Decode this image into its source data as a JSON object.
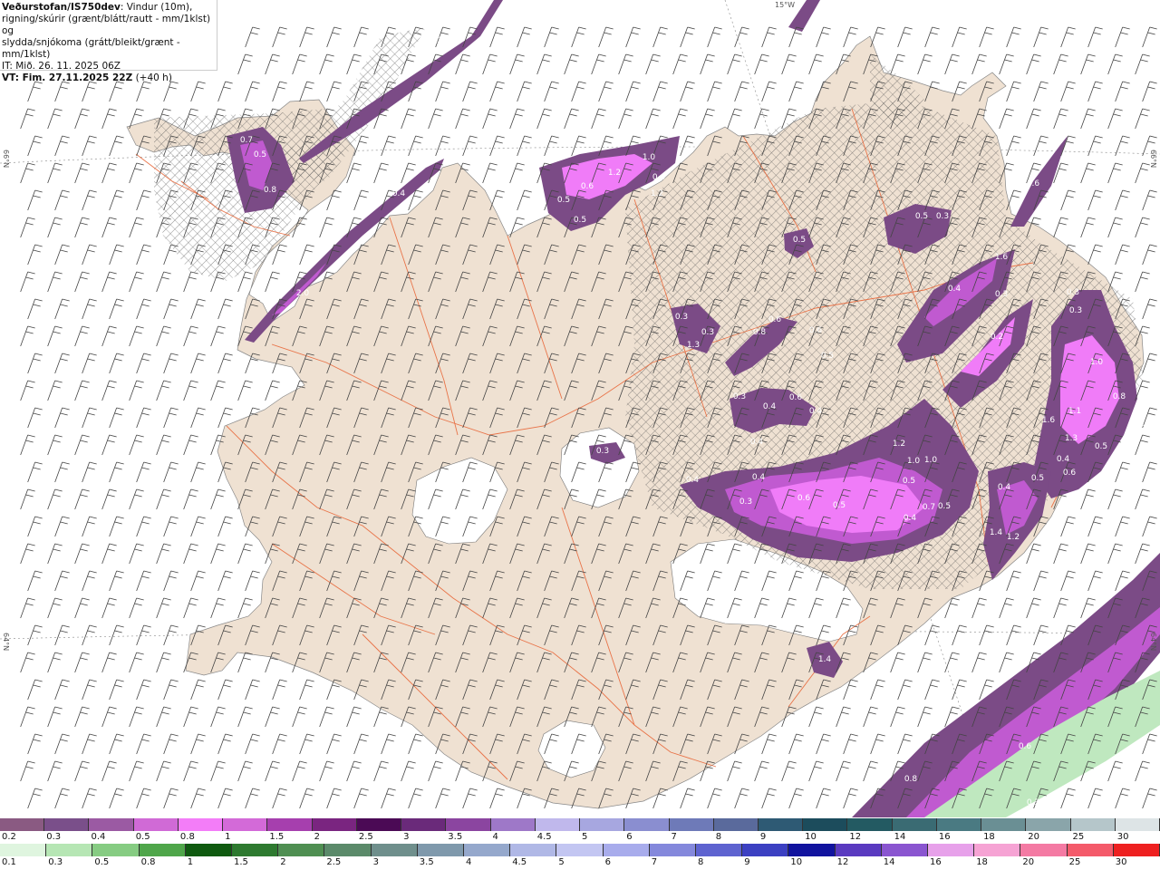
{
  "header": {
    "source": "Veðurstofan/IS750dev",
    "desc1": ": Vindur (10m),",
    "desc2": "rigning/skúrir (grænt/blátt/rautt - mm/1klst) og",
    "desc3": "slydda/snjókoma (grátt/bleikt/grænt - mm/1klst)",
    "it": "IT: Mið. 26. 11. 2025 06Z",
    "vt_label": "VT: Fim. 27.11.2025 22Z",
    "vt_offset": " (+40 h)"
  },
  "graticule": {
    "lat_66": "66°N",
    "lat_64": "64°N",
    "lon_15": "15°W"
  },
  "map_values": [
    "0.7",
    "0.5",
    "0.8",
    "0.5",
    "2.0",
    "0.4",
    "1.0",
    "1.2",
    "0.5",
    "0.6",
    "1.2",
    "0.4",
    "0.5",
    "0.3",
    "0.5",
    "0.3",
    "1.3",
    "1.6",
    "0.4",
    "0.3",
    "0.3",
    "0.8",
    "0.6",
    "0.6",
    "0.5",
    "0.3",
    "0.3",
    "0.2",
    "0.3",
    "0.4",
    "0.6",
    "0.4",
    "1.0",
    "0.8",
    "1.1",
    "1.6",
    "1.3",
    "0.5",
    "0.4",
    "0.6",
    "0.5",
    "0.4",
    "0.4",
    "0.4",
    "0.3",
    "0.6",
    "0.5",
    "0.5",
    "0.4",
    "0.7",
    "0.5",
    "1.2",
    "1.0",
    "1.0",
    "1.2",
    "1.4",
    "1.4",
    "0.6",
    "0.8",
    "0.3",
    "0.4",
    "0.3",
    "0.4",
    "0.4",
    "0.6",
    "0.2"
  ],
  "legend_snow": {
    "labels": [
      "0.2",
      "0.3",
      "0.4",
      "0.5",
      "0.8",
      "1",
      "1.5",
      "2",
      "2.5",
      "3",
      "3.5",
      "4",
      "4.5",
      "5",
      "6",
      "7",
      "8",
      "9",
      "10",
      "12",
      "14",
      "16",
      "18",
      "20",
      "25",
      "30"
    ],
    "colors": [
      "#8a5a82",
      "#7a4f8a",
      "#9b5aa3",
      "#d06ad6",
      "#f37df8",
      "#d36ad8",
      "#a63fae",
      "#7a2580",
      "#4b0a55",
      "#6a2a7a",
      "#8b45a0",
      "#9e78c8",
      "#c0b8ec",
      "#a7a7e0",
      "#8a8ed0",
      "#6e7ab8",
      "#5a6a9c",
      "#2e5a74",
      "#1c4c5c",
      "#235a62",
      "#3a6b73",
      "#4a7a82",
      "#6a8f94",
      "#8aa5aa",
      "#b5c6ca",
      "#dde4e6"
    ]
  },
  "legend_rain": {
    "labels": [
      "0.1",
      "0.3",
      "0.5",
      "0.8",
      "1",
      "1.5",
      "2",
      "2.5",
      "3",
      "3.5",
      "4",
      "4.5",
      "5",
      "6",
      "7",
      "8",
      "9",
      "10",
      "12",
      "14",
      "16",
      "18",
      "20",
      "25",
      "30"
    ],
    "colors": [
      "#dff5df",
      "#b6e6b4",
      "#86cc82",
      "#4fa64a",
      "#0f5a10",
      "#2e7a30",
      "#4f8f52",
      "#5b8a6a",
      "#6f8f8c",
      "#7f99ac",
      "#95a8cc",
      "#b0b8e6",
      "#c3c6f2",
      "#a8acec",
      "#8488dc",
      "#5e63d0",
      "#3c40c2",
      "#11139e",
      "#5a3ac0",
      "#8a55d0",
      "#e7a1ea",
      "#f6a3d4",
      "#f47aa3",
      "#f45a6a",
      "#ee2020"
    ]
  },
  "colors": {
    "land": "#efe1d2",
    "roads": "#e8683a",
    "precip_light": "#7b4b86",
    "precip_mid": "#c05ad0",
    "precip_high": "#f07cf8",
    "rain_green": "#bfe8bf",
    "glacier": "#ffffff"
  }
}
